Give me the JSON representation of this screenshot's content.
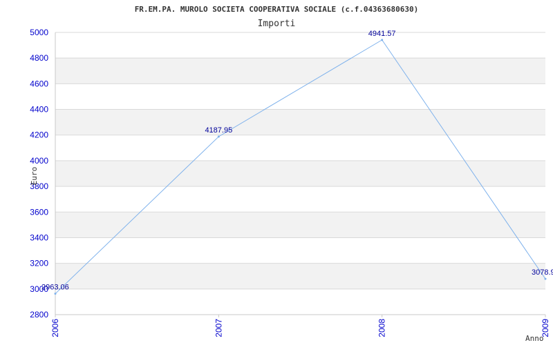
{
  "chart_data": {
    "type": "line",
    "title": "FR.EM.PA. MUROLO SOCIETA COOPERATIVA SOCIALE (c.f.04363680630)",
    "subtitle": "Importi",
    "xlabel": "Anno",
    "ylabel": "Euro",
    "categories": [
      "2006",
      "2007",
      "2008",
      "2009"
    ],
    "values": [
      2963.06,
      4187.95,
      4941.57,
      3078.9
    ],
    "value_labels": [
      "2963.06",
      "4187.95",
      "4941.57",
      "3078.9"
    ],
    "ylim": [
      2800,
      5000
    ],
    "yticks": [
      2800,
      3000,
      3200,
      3400,
      3600,
      3800,
      4000,
      4200,
      4400,
      4600,
      4800,
      5000
    ],
    "grid": true,
    "colors": {
      "line": "#7fb2ec",
      "band": "#f2f2f2",
      "gridline": "#d9d9d9",
      "tick_text": "#0000cc",
      "data_label": "#000099"
    }
  }
}
